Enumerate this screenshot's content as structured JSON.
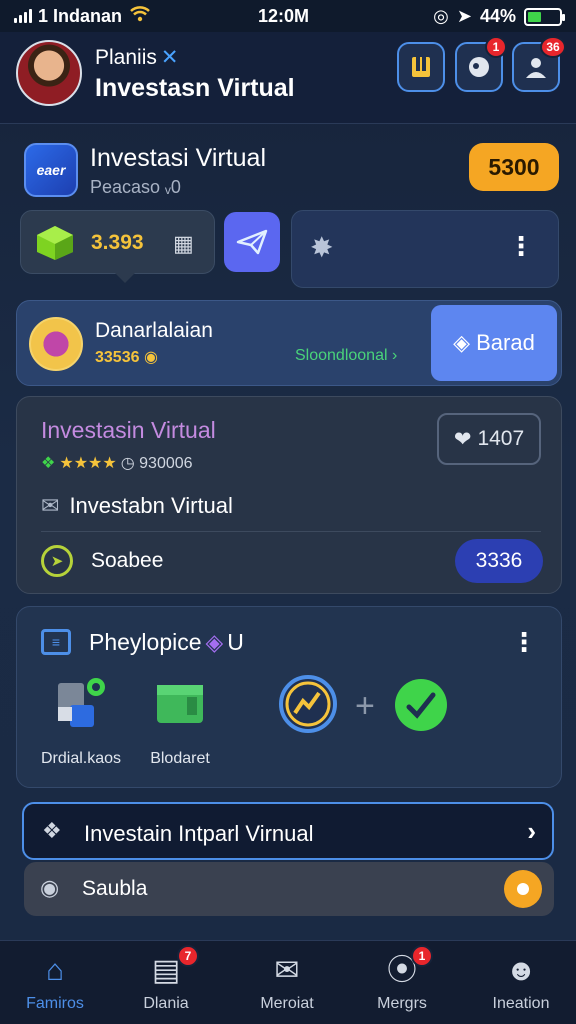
{
  "status_bar": {
    "carrier": "1 Indanan",
    "time": "12:0M",
    "battery": "44%",
    "battery_level": 0.44
  },
  "header": {
    "name": "Planiis",
    "title": "Investasn Virtual",
    "buttons": [
      {
        "icon": "wallet-icon",
        "badge": ""
      },
      {
        "icon": "chat-icon",
        "badge": "1"
      },
      {
        "icon": "profile-icon",
        "badge": "36"
      }
    ]
  },
  "app_card": {
    "icon_text": "eaer",
    "title": "Investasi Virtual",
    "subtitle": "Peacaso ᵥ0",
    "coins": "5300"
  },
  "balance": {
    "value": "3.393"
  },
  "promo": {
    "title": "Danarlalaian",
    "amount": "33536",
    "link": "Sloondloonal",
    "button": "Barad"
  },
  "virtual_card": {
    "title": "Investasin Virtual",
    "rating_stars": "★★★★",
    "rating_value": "930006",
    "count": "1407",
    "row1": "Investabn Virtual",
    "row2": "Soabee",
    "row2_value": "3336"
  },
  "product_card": {
    "title": "Pheylopice",
    "title_suffix": "U",
    "items": [
      "Drdial.kaos",
      "Blodaret"
    ]
  },
  "list": {
    "button": "Investain Intparl Virnual",
    "row": "Saubla"
  },
  "nav": {
    "items": [
      {
        "label": "Famiros",
        "icon": "home-icon",
        "badge": ""
      },
      {
        "label": "Dlania",
        "icon": "document-icon",
        "badge": "7"
      },
      {
        "label": "Meroiat",
        "icon": "mail-icon",
        "badge": ""
      },
      {
        "label": "Mergrs",
        "icon": "compass-icon",
        "badge": "1"
      },
      {
        "label": "Ineation",
        "icon": "user-icon",
        "badge": ""
      }
    ]
  },
  "colors": {
    "accent": "#4d8fe8",
    "coin": "#f5a623",
    "badge": "#e8262c"
  }
}
